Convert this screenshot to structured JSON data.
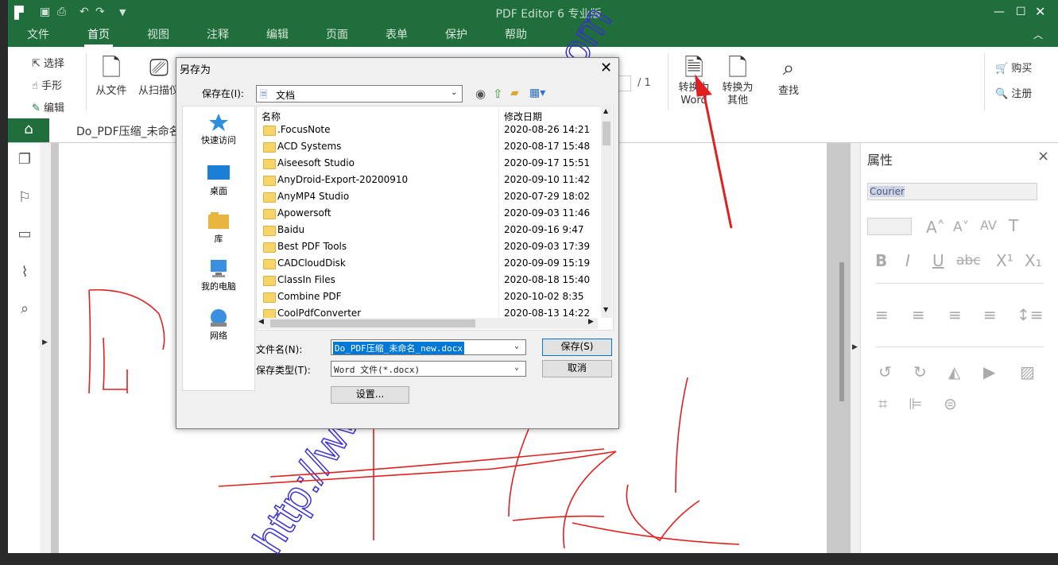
{
  "window": {
    "title": "PDF Editor 6 专业版"
  },
  "menu": [
    "文件",
    "首页",
    "视图",
    "注释",
    "编辑",
    "页面",
    "表单",
    "保护",
    "帮助"
  ],
  "ribbon": {
    "select": "选择",
    "hand": "手形",
    "edit": "编辑",
    "from_file": "从文件",
    "from_scanner": "从扫描仪",
    "page_sep": "/ 1",
    "to_word_1": "转换为",
    "to_word_2": "Word",
    "to_other_1": "转换为",
    "to_other_2": "其他",
    "find": "查找",
    "buy": "购买",
    "register": "注册"
  },
  "tab": {
    "doc_title": "Do_PDF压缩_未命名"
  },
  "props": {
    "title": "属性",
    "font": "Courier"
  },
  "dialog": {
    "title": "另存为",
    "save_in_label": "保存在(I):",
    "save_in_value": "文档",
    "places": [
      "快速访问",
      "桌面",
      "库",
      "我的电脑",
      "网络"
    ],
    "col_name": "名称",
    "col_date": "修改日期",
    "files": [
      {
        "name": ".FocusNote",
        "date": "2020-08-26 14:21"
      },
      {
        "name": "ACD Systems",
        "date": "2020-08-17 15:48"
      },
      {
        "name": "Aiseesoft Studio",
        "date": "2020-09-17 15:51"
      },
      {
        "name": "AnyDroid-Export-20200910",
        "date": "2020-09-10 11:42"
      },
      {
        "name": "AnyMP4 Studio",
        "date": "2020-07-29 18:02"
      },
      {
        "name": "Apowersoft",
        "date": "2020-09-03 11:46"
      },
      {
        "name": "Baidu",
        "date": "2020-09-16 9:47"
      },
      {
        "name": "Best PDF Tools",
        "date": "2020-09-03 17:39"
      },
      {
        "name": "CADCloudDisk",
        "date": "2020-09-09 15:19"
      },
      {
        "name": "ClassIn Files",
        "date": "2020-08-18 15:40"
      },
      {
        "name": "Combine PDF",
        "date": "2020-10-02 8:35"
      },
      {
        "name": "CoolPdfConverter",
        "date": "2020-08-13 14:22"
      }
    ],
    "filename_label": "文件名(N):",
    "filename_value": "Do_PDF压缩_未命名_new.docx",
    "filetype_label": "保存类型(T):",
    "filetype_value": "Word 文件(*.docx)",
    "save_button": "保存(S)",
    "cancel_button": "取消",
    "settings_button": "设置..."
  },
  "colors": {
    "brand_green": "#1f6e3c",
    "arrow_red": "#e02020",
    "watermark_blue": "#3a2fd0"
  }
}
